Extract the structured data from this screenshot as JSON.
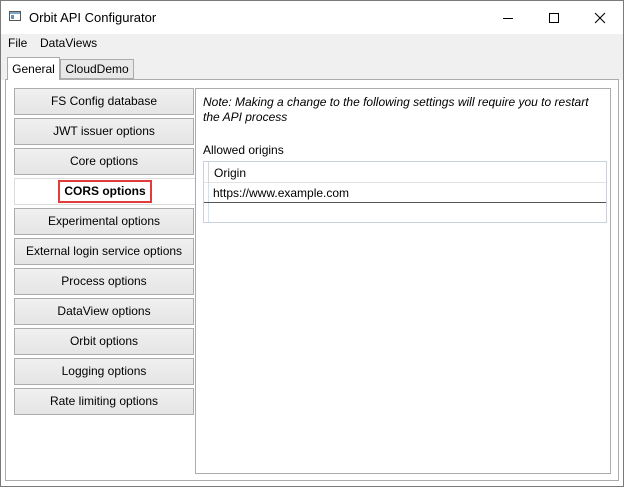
{
  "window": {
    "title": "Orbit API Configurator"
  },
  "menu": {
    "file": "File",
    "dataviews": "DataViews"
  },
  "tabs": [
    {
      "label": "General",
      "selected": true
    },
    {
      "label": "CloudDemo",
      "selected": false
    }
  ],
  "nav": {
    "items": [
      {
        "label": "FS Config database"
      },
      {
        "label": "JWT issuer options"
      },
      {
        "label": "Core options"
      },
      {
        "label": "CORS options",
        "selected": true
      },
      {
        "label": "Experimental options"
      },
      {
        "label": "External login service options"
      },
      {
        "label": "Process options"
      },
      {
        "label": "DataView options"
      },
      {
        "label": "Orbit options"
      },
      {
        "label": "Logging options"
      },
      {
        "label": "Rate limiting options"
      }
    ]
  },
  "panel": {
    "note": "Note: Making a change to the following settings will require you to restart the API process",
    "allowed_origins_label": "Allowed origins",
    "grid": {
      "column_header": "Origin",
      "rows": [
        "https://www.example.com"
      ]
    }
  },
  "colors": {
    "highlight_border": "#e03c3c",
    "button_face": "#f0f0f0",
    "border": "#acacac"
  },
  "icons": {
    "app": "window-app-icon",
    "minimize": "minimize-icon",
    "maximize": "maximize-icon",
    "close": "close-icon"
  }
}
